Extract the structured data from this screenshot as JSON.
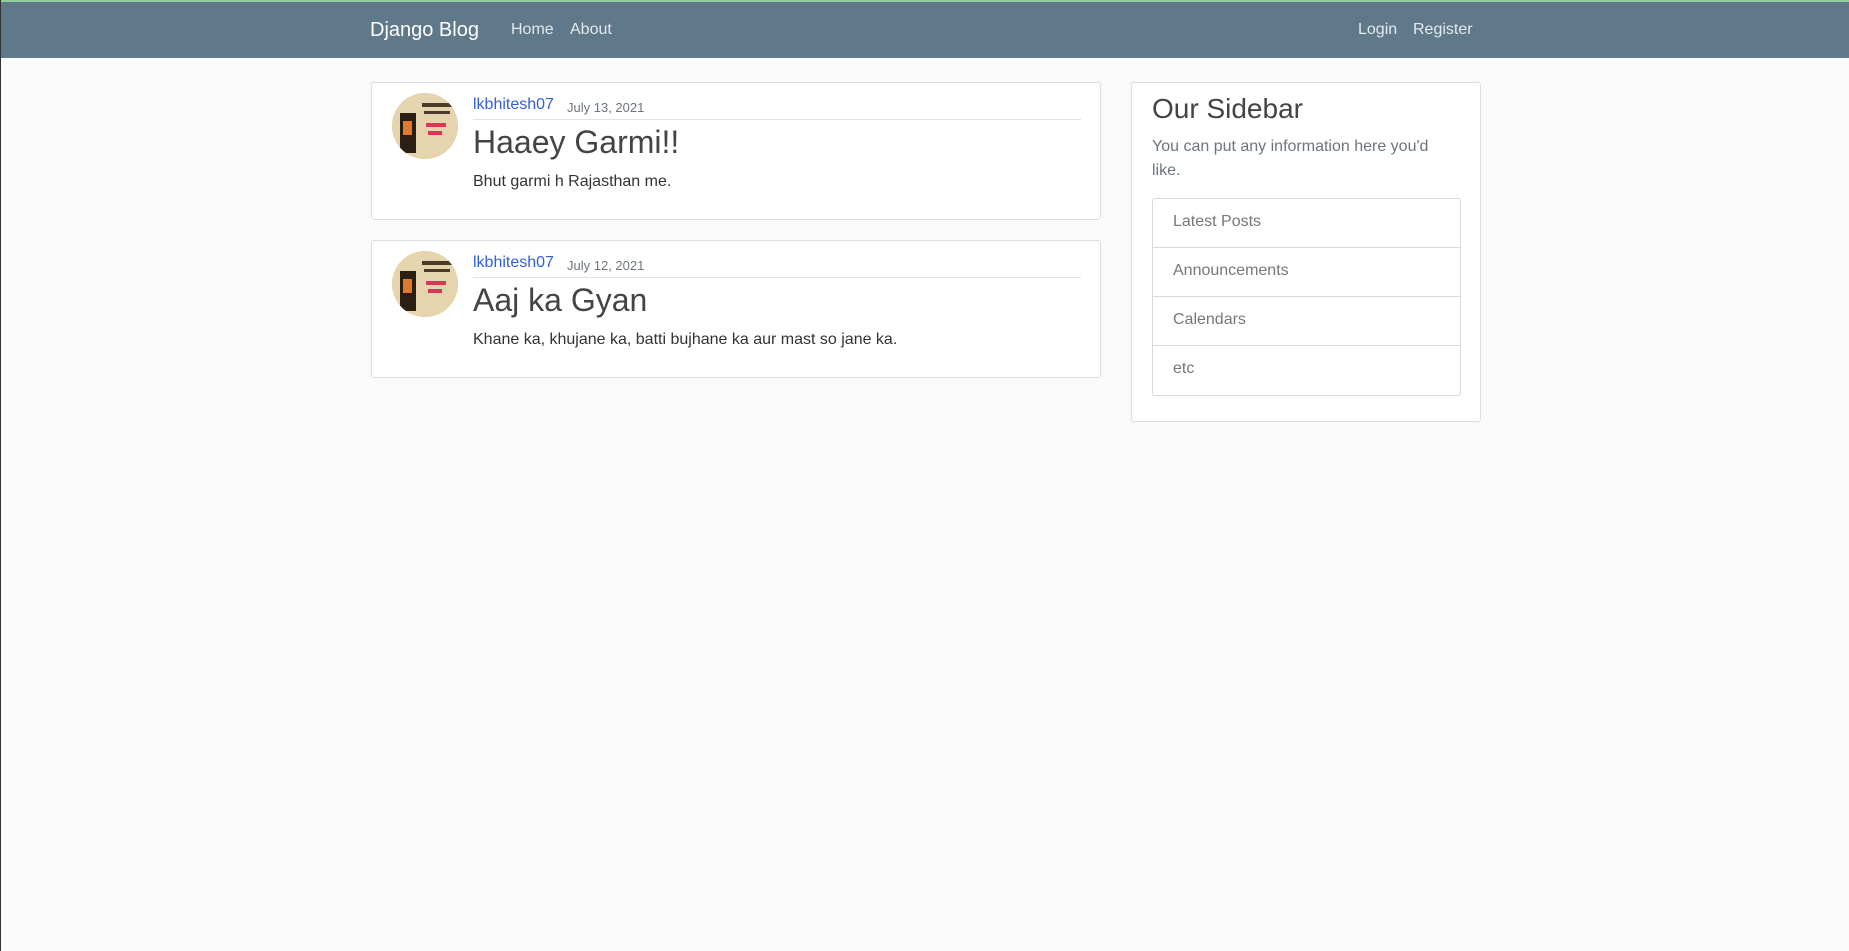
{
  "nav": {
    "brand": "Django Blog",
    "home": "Home",
    "about": "About",
    "login": "Login",
    "register": "Register"
  },
  "posts": [
    {
      "author": "lkbhitesh07",
      "date": "July 13, 2021",
      "title": "Haaey Garmi!!",
      "content": "Bhut garmi h Rajasthan me."
    },
    {
      "author": "lkbhitesh07",
      "date": "July 12, 2021",
      "title": "Aaj ka Gyan",
      "content": "Khane ka, khujane ka, batti bujhane ka aur mast so jane ka."
    }
  ],
  "sidebar": {
    "title": "Our Sidebar",
    "description": "You can put any information here you'd like.",
    "items": [
      "Latest Posts",
      "Announcements",
      "Calendars",
      "etc"
    ]
  }
}
